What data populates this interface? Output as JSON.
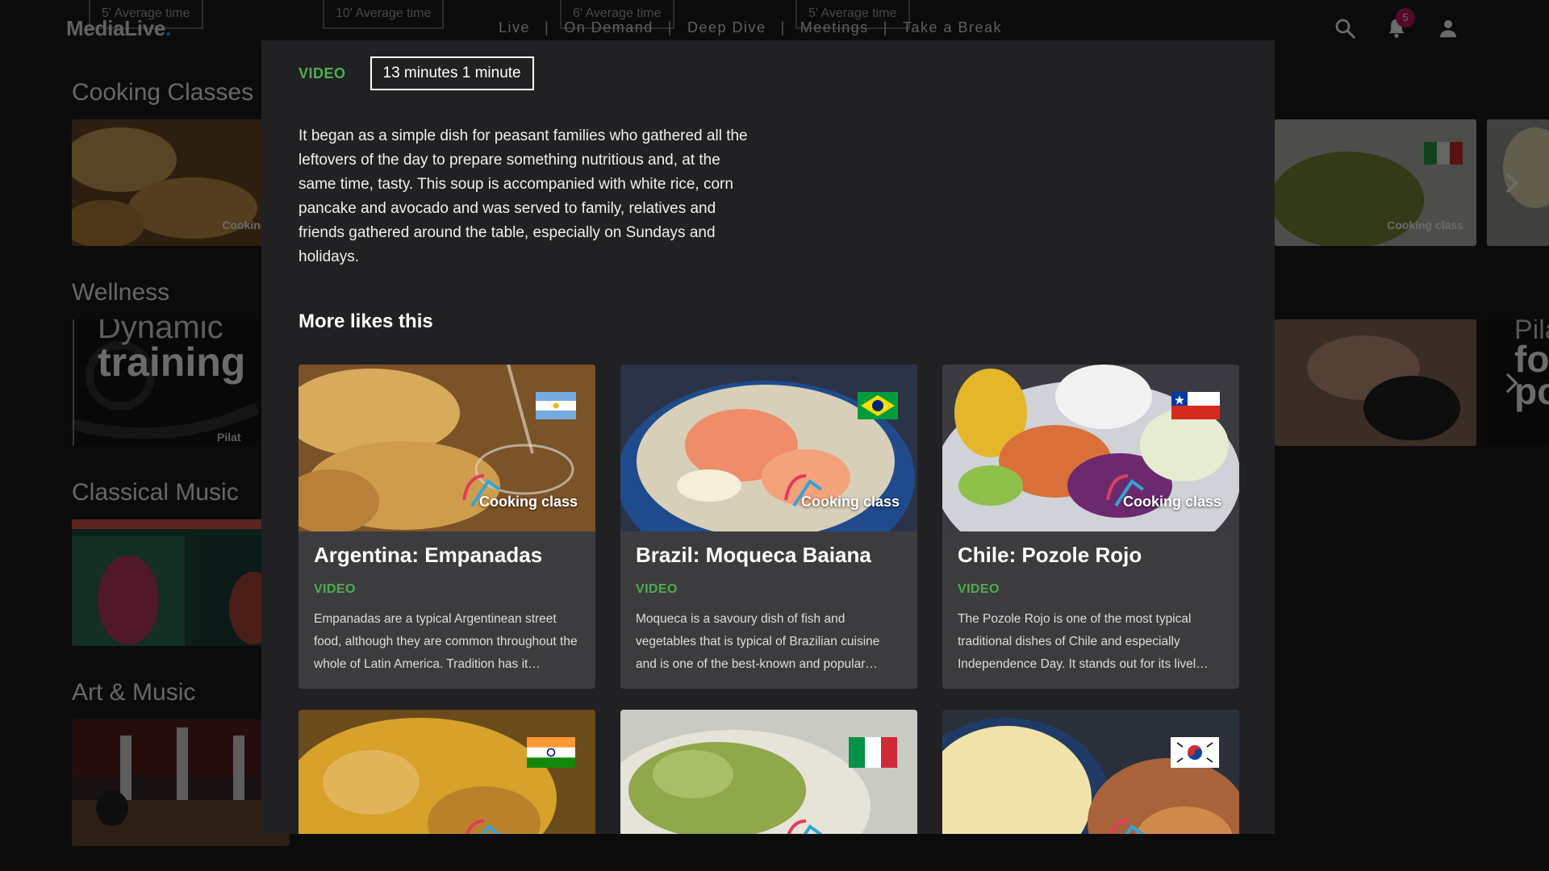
{
  "app": {
    "logo_main": "MediaLive",
    "logo_dot": "."
  },
  "background": {
    "ghost_tabs": [
      "5' Average time",
      "10' Average time",
      "6' Average time",
      "5' Average time"
    ],
    "nav": [
      "Live",
      "On Demand",
      "Deep Dive",
      "Meetings",
      "Take a Break"
    ],
    "notification_count": "5",
    "rows": [
      {
        "title": "Cooking Classes",
        "thumb_caption": "Cooking c",
        "right_caption": "Cooking class"
      },
      {
        "title": "Wellness",
        "thumb_line1": "Dynamic",
        "thumb_line2": "training",
        "thumb_line3": "Pilat",
        "right_line1": "Pila",
        "right_line2": "fo",
        "right_line3": "po"
      },
      {
        "title": "Classical Music"
      },
      {
        "title": "Art & Music"
      }
    ],
    "colors": {
      "accent": "#4caf50",
      "badge": "#c2185b",
      "logo_dot": "#38a9ff"
    }
  },
  "modal": {
    "kind": "VIDEO",
    "duration": "13 minutes 1 minute",
    "description": "It began as a simple dish for peasant families who gathered all the leftovers of the day to prepare something nutritious and, at the same time, tasty. This soup is accompanied with white rice, corn pancake and avocado and was served to family, relatives and friends gathered around the table, especially on Sundays and holidays.",
    "more_title": "More likes this",
    "cards": [
      {
        "title": "Argentina: Empanadas",
        "kind": "VIDEO",
        "caption": "Cooking class",
        "flag": "argentina-flag",
        "desc": "Empanadas are a typical Argentinean street food, although they are common throughout the whole of Latin America. Tradition has it…"
      },
      {
        "title": "Brazil: Moqueca Baiana",
        "kind": "VIDEO",
        "caption": "Cooking class",
        "flag": "brazil-flag",
        "desc": "Moqueca is a savoury dish of fish and vegetables that is typical of Brazilian cuisine and is one of the best-known and popular…"
      },
      {
        "title": "Chile: Pozole Rojo",
        "kind": "VIDEO",
        "caption": "Cooking class",
        "flag": "chile-flag",
        "desc": "The Pozole Rojo is one of the most typical traditional dishes of Chile and especially Independence Day. It stands out for its livel…"
      },
      {
        "flag": "india-flag"
      },
      {
        "flag": "italy-flag"
      },
      {
        "flag": "south-korea-flag"
      }
    ]
  }
}
